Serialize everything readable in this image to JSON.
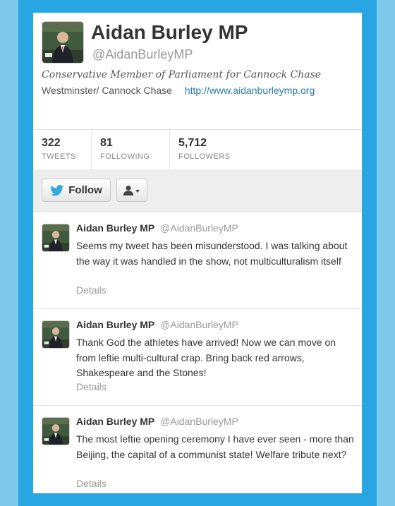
{
  "profile": {
    "name": "Aidan Burley MP",
    "handle": "@AidanBurleyMP",
    "bio": "Conservative Member of Parliament for Cannock Chase",
    "location": "Westminster/ Cannock Chase",
    "url": "http://www.aidanburleymp.org"
  },
  "stats": [
    {
      "value": "322",
      "label": "TWEETS"
    },
    {
      "value": "81",
      "label": "FOLLOWING"
    },
    {
      "value": "5,712",
      "label": "FOLLOWERS"
    }
  ],
  "actions": {
    "follow_label": "Follow",
    "follow_icon": "twitter-bird-icon",
    "user_menu_icon": "user-dropdown-icon"
  },
  "tweets": [
    {
      "name": "Aidan Burley MP",
      "handle": "@AidanBurleyMP",
      "text": "Seems my tweet has been misunderstood. I was talking about the way it was handled in the show, not multiculturalism itself",
      "details": "Details"
    },
    {
      "name": "Aidan Burley MP",
      "handle": "@AidanBurleyMP",
      "text": "Thank God the athletes have arrived! Now we can move on from leftie multi-cultural crap. Bring back red arrows, Shakespeare and the Stones!",
      "details": "Details"
    },
    {
      "name": "Aidan Burley MP",
      "handle": "@AidanBurleyMP",
      "text": "The most leftie opening ceremony I have ever seen - more than Beijing, the capital of a communist state! Welfare tribute next?",
      "details": "Details"
    }
  ],
  "colors": {
    "background": "#7ec9ec",
    "frame": "#27a6e3",
    "twitter_blue": "#2fa9e0",
    "link": "#2a78a8"
  }
}
